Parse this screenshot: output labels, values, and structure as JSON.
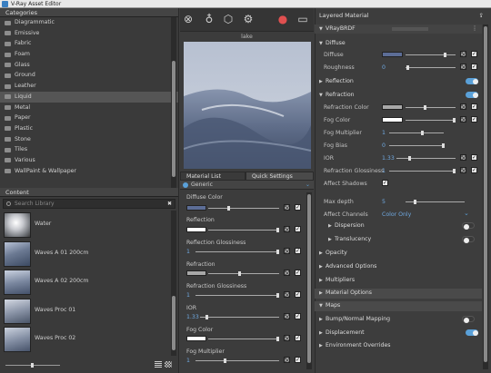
{
  "window": {
    "title": "V-Ray Asset Editor"
  },
  "categories": {
    "header": "Categories",
    "items": [
      "Diagrammatic",
      "Emissive",
      "Fabric",
      "Foam",
      "Glass",
      "Ground",
      "Leather",
      "Liquid",
      "Metal",
      "Paper",
      "Plastic",
      "Stone",
      "Tiles",
      "Various",
      "WallPaint & Wallpaper"
    ],
    "selected": "Liquid"
  },
  "content": {
    "header": "Content",
    "search_placeholder": "Search Library",
    "items": [
      "Water",
      "Waves A 01 200cm",
      "Waves A 02 200cm",
      "Waves Proc 01",
      "Waves Proc 02"
    ]
  },
  "preview": {
    "label": "lake"
  },
  "mid_tabs": {
    "material_list": "Material List",
    "quick_settings": "Quick Settings"
  },
  "generic": "Generic",
  "quick_settings": {
    "diffuse_color": "Diffuse Color",
    "reflection": "Reflection",
    "reflection_glossiness": "Reflection Glossiness",
    "reflection_glossiness_value": "1",
    "refraction": "Refraction",
    "refraction_glossiness": "Refraction Glossiness",
    "refraction_glossiness_value": "1",
    "ior": "IOR",
    "ior_value": "1.33",
    "fog_color": "Fog Color",
    "fog_multiplier": "Fog Multiplier",
    "fog_multiplier_value": "1"
  },
  "right": {
    "header": "Layered Material",
    "brdf": "VRayBRDF",
    "diffuse_section": "Diffuse",
    "diffuse": "Diffuse",
    "roughness": "Roughness",
    "roughness_value": "0",
    "reflection_section": "Reflection",
    "refraction_section": "Refraction",
    "refraction_color": "Refraction Color",
    "fog_color": "Fog Color",
    "fog_multiplier": "Fog Multiplier",
    "fog_multiplier_value": "1",
    "fog_bias": "Fog Bias",
    "fog_bias_value": "0",
    "ior": "IOR",
    "ior_value": "1.33",
    "refraction_glossiness": "Refraction Glossiness",
    "refraction_glossiness_value": "1",
    "affect_shadows": "Affect Shadows",
    "max_depth": "Max depth",
    "max_depth_value": "5",
    "affect_channels": "Affect Channels",
    "affect_channels_value": "Color Only",
    "dispersion": "Dispersion",
    "translucency": "Translucency",
    "opacity": "Opacity",
    "advanced_options": "Advanced Options",
    "multipliers": "Multipliers",
    "material_options": "Material Options",
    "maps": "Maps",
    "bump_normal": "Bump/Normal Mapping",
    "displacement": "Displacement",
    "environment_overrides": "Environment Overrides"
  },
  "colors": {
    "accent": "#5aa0d8",
    "diffuse_swatch": "#5c6d96",
    "refraction_swatch": "#a8a8a8",
    "fog_swatch": "#ffffff"
  }
}
